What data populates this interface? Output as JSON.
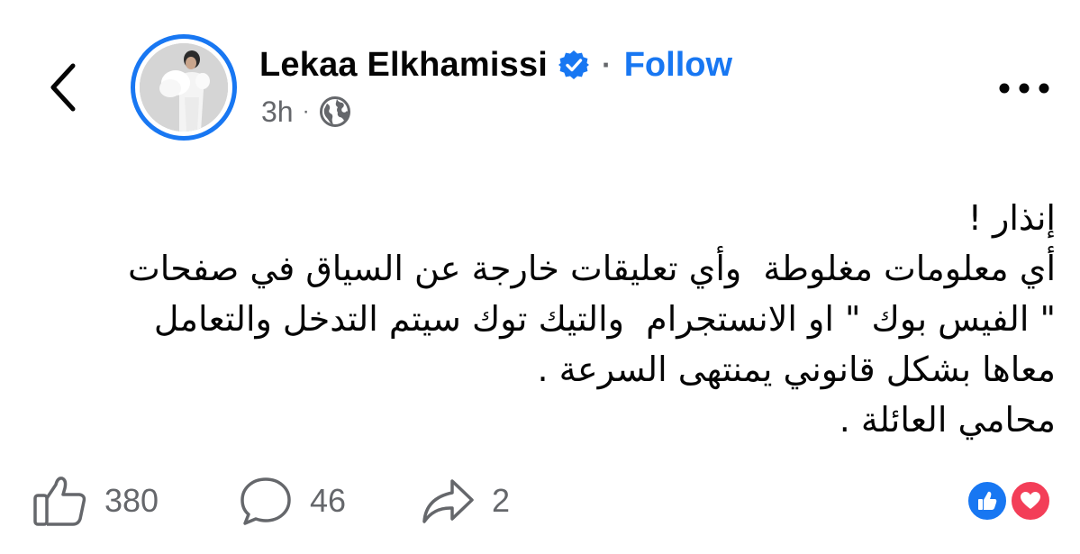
{
  "post": {
    "author": "Lekaa Elkhamissi",
    "separator": "·",
    "follow_label": "Follow",
    "timestamp": "3h",
    "meta_separator": "·",
    "body_lines": [
      "إنذار !",
      "أي معلومات مغلوطة  وأي تعليقات خارجة عن السياق في صفحات",
      "\" الفيس بوك \" او الانستجرام  والتيك توك سيتم التدخل والتعامل",
      "معاها بشكل قانوني يمنتهى السرعة .",
      "محامي العائلة ."
    ]
  },
  "stats": {
    "likes": "380",
    "comments": "46",
    "shares": "2"
  },
  "icons": {
    "back": "chevron-left-icon",
    "verified": "verified-badge-icon",
    "audience": "globe-icon",
    "more": "more-horizontal-icon",
    "like": "thumbs-up-icon",
    "comment": "comment-bubble-icon",
    "share": "share-arrow-icon",
    "reaction_like": "like-reaction-icon",
    "reaction_love": "love-reaction-icon"
  },
  "colors": {
    "accent": "#1877f2",
    "text": "#050505",
    "secondary": "#65676b",
    "love": "#f33e58"
  }
}
